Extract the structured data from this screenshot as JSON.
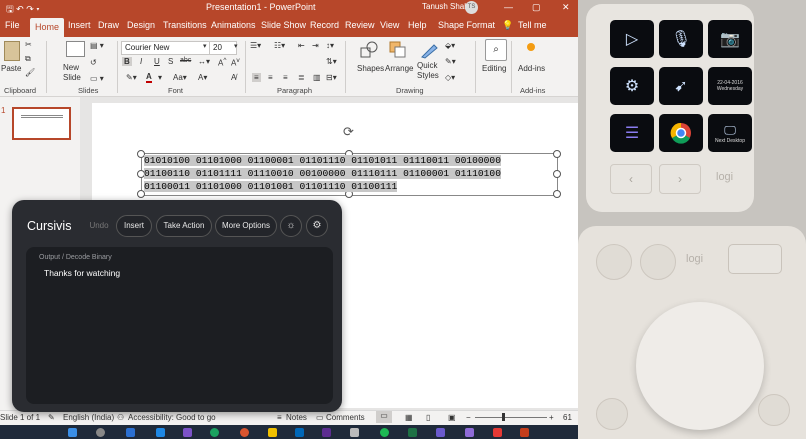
{
  "titlebar": {
    "doc_title": "Presentation1  -  PowerPoint",
    "user": "Tanush Shah",
    "user_initials": "TS"
  },
  "tabs": [
    "File",
    "Home",
    "Insert",
    "Draw",
    "Design",
    "Transitions",
    "Animations",
    "Slide Show",
    "Record",
    "Review",
    "View",
    "Help",
    "Shape Format",
    "Tell me"
  ],
  "ribbon": {
    "paste": "Paste",
    "new_slide": "New\nSlide",
    "font_name": "Courier New",
    "font_size": "20",
    "shapes": "Shapes",
    "arrange": "Arrange",
    "quick_styles": "Quick\nStyles",
    "editing": "Editing",
    "addins": "Add-ins",
    "groups": [
      "Clipboard",
      "Slides",
      "Font",
      "Paragraph",
      "Drawing",
      "Add-ins"
    ]
  },
  "slide_number": "1",
  "binary_lines": [
    "01010100 01101000 01100001 01101110 01101011 01110011 00100000",
    "01100110 01101111 01110010 00100000 01110111 01100001 01110100",
    "01100011 01101000 01101001 01101110 01100111"
  ],
  "cursivis": {
    "title": "Cursivis",
    "undo": "Undo",
    "insert": "Insert",
    "take_action": "Take Action",
    "more_options": "More Options",
    "crumb": "Output  /  Decode Binary",
    "output": "Thanks for watching"
  },
  "statusbar": {
    "slide": "Slide 1 of 1",
    "language": "English (India)",
    "accessibility": "Accessibility: Good to go",
    "notes": "Notes",
    "comments": "Comments",
    "zoom": "61"
  },
  "deck": {
    "logo": "logi",
    "next_desktop": "Next Desktop",
    "date": "22-04-2016",
    "day": "Wednesday"
  },
  "dial": {
    "logo": "logi"
  },
  "colors": {
    "ppt_accent": "#b7472a",
    "cursivis_bg": "#2a2c31"
  }
}
